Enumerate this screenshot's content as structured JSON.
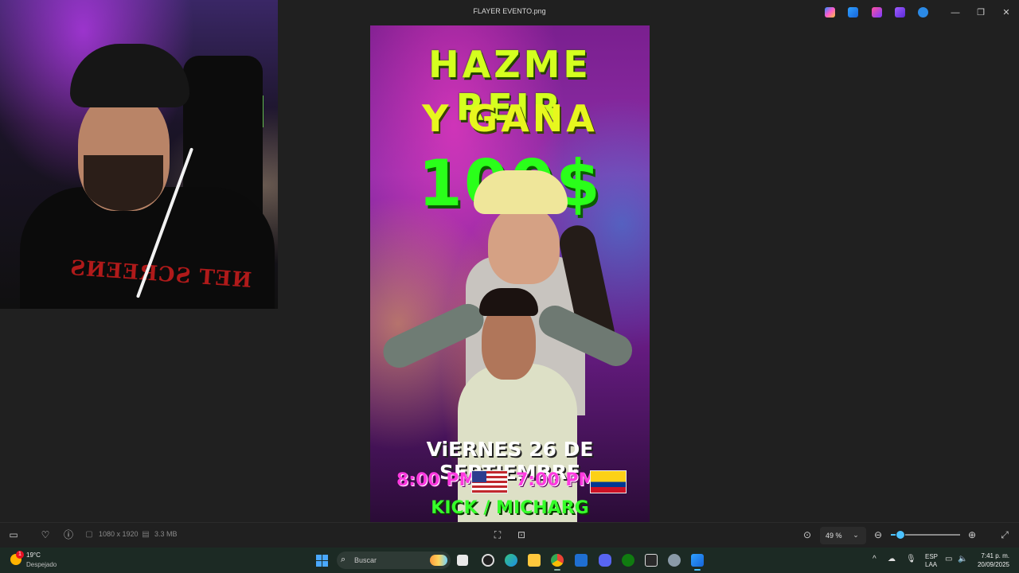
{
  "window": {
    "title": "FLAYER EVENTO.png",
    "minimize_label": "—",
    "maximize_label": "❐",
    "close_label": "✕"
  },
  "flyer": {
    "line1": "HAZME REIR",
    "line2": "Y GANA",
    "prize": "100$",
    "date": "ViERNES 26 DE SEPTIEMBRE",
    "time_us": "8:00 PM",
    "time_co": "7:00 PM",
    "channel": "KICK / MICHARG"
  },
  "webcam": {
    "shirt_print": "ƧИƎƎЯƆƧ TƎИ"
  },
  "viewer_bar": {
    "dimensions": "1080 x 1920",
    "file_size": "3.3 MB",
    "zoom": "49 %"
  },
  "taskbar": {
    "weather_temp": "19°C",
    "weather_desc": "Despejado",
    "weather_badge": "1",
    "search_placeholder": "Buscar",
    "lang_line1": "ESP",
    "lang_line2": "LAA",
    "time": "7:41 p. m.",
    "date": "20/09/2025"
  },
  "colors": {
    "accent": "#4cc2ff",
    "flyer_green": "#2aff1a",
    "flyer_magenta": "#ff39e0"
  }
}
